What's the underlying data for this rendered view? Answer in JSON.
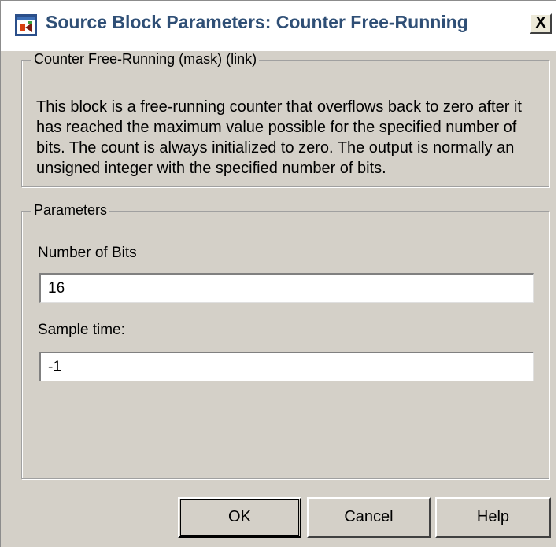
{
  "window": {
    "title": "Source Block Parameters: Counter Free-Running",
    "close_label": "X"
  },
  "description_group": {
    "legend": "Counter Free-Running (mask) (link)",
    "text": "This block is a free-running counter that overflows back to zero after it has reached the maximum value possible for the specified number of bits. The count is always initialized to zero.  The output is normally an unsigned integer with the specified number of bits."
  },
  "parameters_group": {
    "legend": "Parameters",
    "fields": [
      {
        "label": "Number of Bits",
        "value": "16"
      },
      {
        "label": "Sample time:",
        "value": "-1"
      }
    ]
  },
  "buttons": {
    "ok": "OK",
    "cancel": "Cancel",
    "help": "Help"
  },
  "icons": {
    "app": "simulink-block-icon",
    "close": "close-icon"
  }
}
